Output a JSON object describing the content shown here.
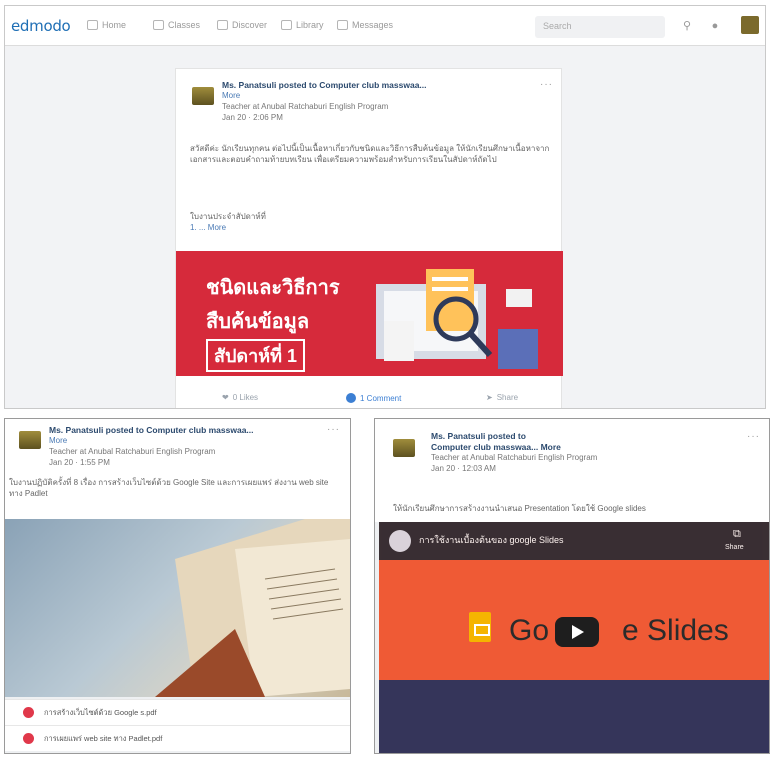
{
  "topbar": {
    "logo": "edmodo",
    "nav": [
      "Home",
      "Classes",
      "Discover",
      "Library",
      "Messages"
    ],
    "search_placeholder": "Search"
  },
  "main_post": {
    "author_line": "Ms. Panatsuli posted to Computer club masswaa...",
    "more": "More",
    "role_line": "Teacher at Anubal Ratchaburi English Program",
    "time": "Jan 20 · 2:06 PM",
    "body": "สวัสดีค่ะ นักเรียนทุกคน ต่อไปนี้เป็นเนื้อหาเกี่ยวกับชนิดและวิธีการสืบค้นข้อมูล ให้นักเรียนศึกษาเนื้อหาจากเอกสารและตอบคำถามท้ายบทเรียน เพื่อเตรียมความพร้อมสำหรับการเรียนในสัปดาห์ถัดไป",
    "footer_line": "ใบงานประจำสัปดาห์ที่",
    "footer_more": "1. ... More",
    "banner": {
      "line1": "ชนิดและวิธีการ",
      "line2": "สืบค้นข้อมูล",
      "line3": "สัปดาห์ที่ 1"
    },
    "actions": [
      "0 Likes",
      "1 Comment",
      "Share"
    ]
  },
  "left_post": {
    "author_line": "Ms. Panatsuli posted to Computer club masswaa...",
    "more": "More",
    "role_line": "Teacher at Anubal Ratchaburi English Program",
    "time": "Jan 20 · 1:55 PM",
    "body": "ใบงานปฏิบัติครั้งที่ 8 เรื่อง การสร้างเว็บไซต์ด้วย Google Site และการเผยแพร่ ส่งงาน web site ทาง Padlet",
    "attachments": [
      "การสร้างเว็บไซต์ด้วย Google s.pdf",
      "การเผยแพร่ web site ทาง Padlet.pdf"
    ]
  },
  "right_post": {
    "author_line": "Ms. Panatsuli posted to",
    "group_line": "Computer club masswaa... More",
    "role_line": "Teacher at Anubal Ratchaburi English Program",
    "time": "Jan 20 · 12:03 AM",
    "body": "ให้นักเรียนศึกษาการสร้างงานนำเสนอ Presentation โดยใช้ Google slides",
    "video_title": "การใช้งานเบื้องต้นของ google Slides",
    "video_share": "Share",
    "video_logo_left": "Go",
    "video_logo_right": "e Slides"
  }
}
